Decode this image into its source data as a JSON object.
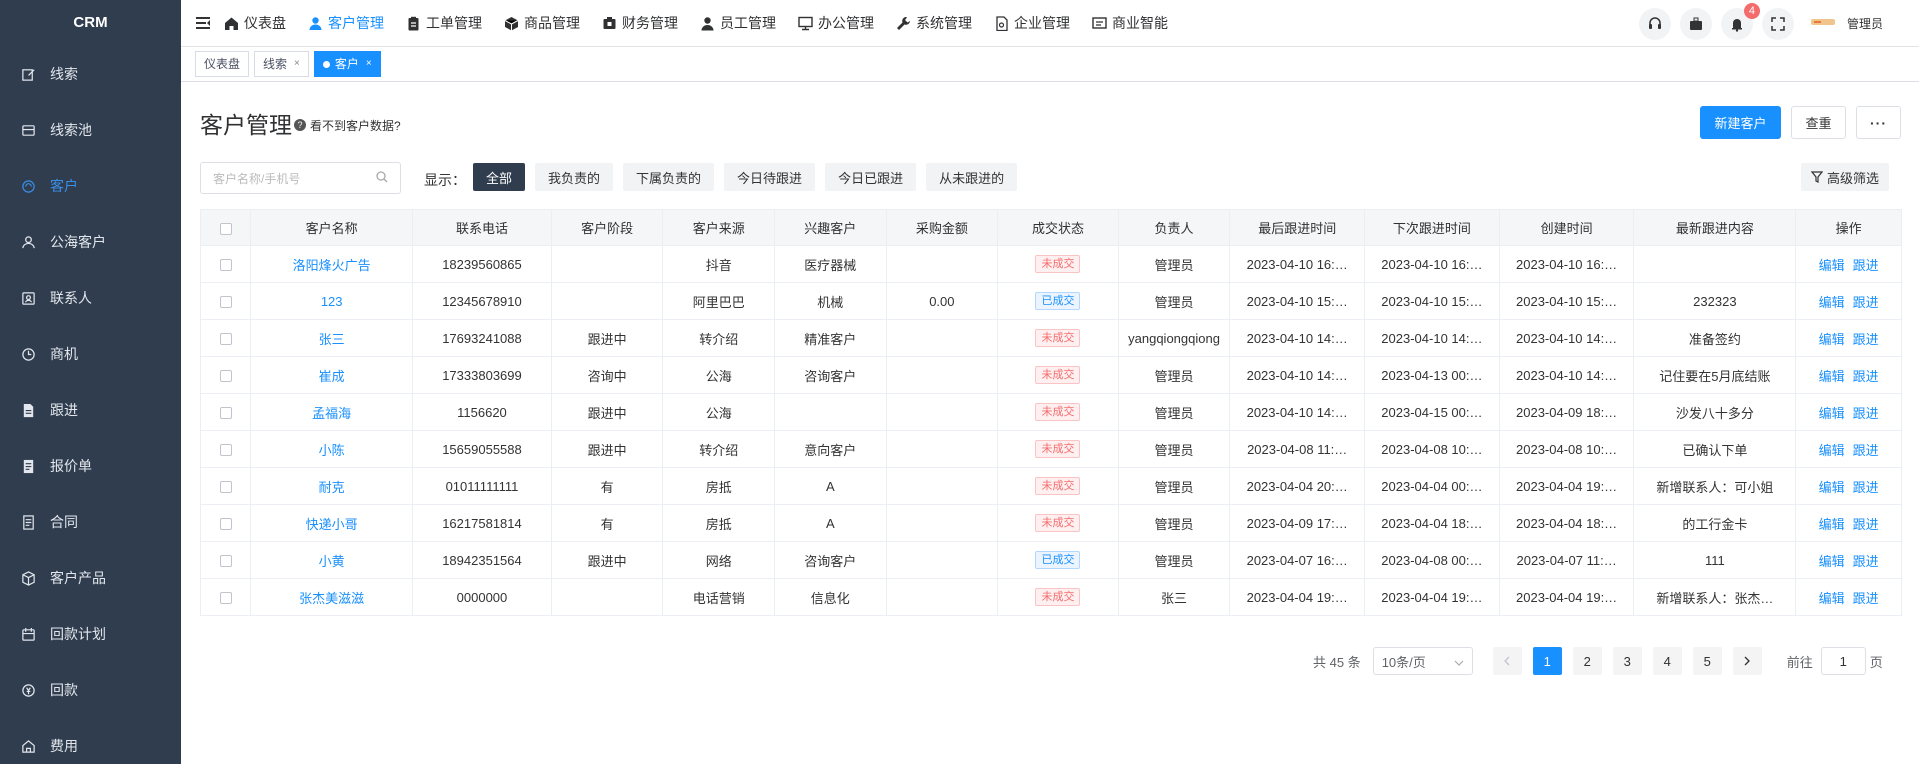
{
  "sidebar": {
    "brand": "CRM",
    "items": [
      {
        "label": "线索",
        "icon": "edit-icon"
      },
      {
        "label": "线索池",
        "icon": "pool-icon"
      },
      {
        "label": "客户",
        "icon": "customer-icon",
        "active": true
      },
      {
        "label": "公海客户",
        "icon": "user-icon"
      },
      {
        "label": "联系人",
        "icon": "contact-icon"
      },
      {
        "label": "商机",
        "icon": "opportunity-icon"
      },
      {
        "label": "跟进",
        "icon": "followup-icon"
      },
      {
        "label": "报价单",
        "icon": "quote-icon"
      },
      {
        "label": "合同",
        "icon": "contract-icon"
      },
      {
        "label": "客户产品",
        "icon": "product-icon"
      },
      {
        "label": "回款计划",
        "icon": "plan-icon"
      },
      {
        "label": "回款",
        "icon": "payment-icon"
      },
      {
        "label": "费用",
        "icon": "expense-icon"
      }
    ]
  },
  "topnav": {
    "items": [
      {
        "label": "仪表盘",
        "icon": "home-icon"
      },
      {
        "label": "客户管理",
        "icon": "user-icon",
        "active": true
      },
      {
        "label": "工单管理",
        "icon": "clipboard-icon"
      },
      {
        "label": "商品管理",
        "icon": "box-icon"
      },
      {
        "label": "财务管理",
        "icon": "finance-icon"
      },
      {
        "label": "员工管理",
        "icon": "staff-icon"
      },
      {
        "label": "办公管理",
        "icon": "office-icon"
      },
      {
        "label": "系统管理",
        "icon": "wrench-icon"
      },
      {
        "label": "企业管理",
        "icon": "enterprise-icon"
      },
      {
        "label": "商业智能",
        "icon": "bi-icon"
      }
    ],
    "notification_count": "4",
    "admin_name": "管理员"
  },
  "tabs": [
    {
      "label": "仪表盘",
      "closable": false
    },
    {
      "label": "线索",
      "closable": true
    },
    {
      "label": "客户",
      "closable": true,
      "active": true
    }
  ],
  "page": {
    "title": "客户管理",
    "help_text": "看不到客户数据?",
    "new_button": "新建客户",
    "recheck_button": "查重",
    "more_button": "···",
    "search_placeholder": "客户名称/手机号",
    "show_label": "显示：",
    "filters": [
      "全部",
      "我负责的",
      "下属负责的",
      "今日待跟进",
      "今日已跟进",
      "从未跟进的"
    ],
    "active_filter": "全部",
    "advanced_filter": "高级筛选"
  },
  "table": {
    "headers": [
      "客户名称",
      "联系电话",
      "客户阶段",
      "客户来源",
      "兴趣客户",
      "采购金额",
      "成交状态",
      "负责人",
      "最后跟进时间",
      "下次跟进时间",
      "创建时间",
      "最新跟进内容",
      "操作"
    ],
    "rows": [
      [
        "洛阳烽火广告",
        "18239560865",
        "",
        "抖音",
        "医疗器械",
        "",
        "未成交",
        "管理员",
        "2023-04-10 16:…",
        "2023-04-10 16:…",
        "2023-04-10 16:…",
        ""
      ],
      [
        "123",
        "12345678910",
        "",
        "阿里巴巴",
        "机械",
        "0.00",
        "已成交",
        "管理员",
        "2023-04-10 15:…",
        "2023-04-10 15:…",
        "2023-04-10 15:…",
        "232323"
      ],
      [
        "张三",
        "17693241088",
        "跟进中",
        "转介绍",
        "精准客户",
        "",
        "未成交",
        "yangqiongqiong",
        "2023-04-10 14:…",
        "2023-04-10 14:…",
        "2023-04-10 14:…",
        "准备签约"
      ],
      [
        "崔成",
        "17333803699",
        "咨询中",
        "公海",
        "咨询客户",
        "",
        "未成交",
        "管理员",
        "2023-04-10 14:…",
        "2023-04-13 00:…",
        "2023-04-10 14:…",
        "记住要在5月底结账"
      ],
      [
        "孟福海",
        "1156620",
        "跟进中",
        "公海",
        "",
        "",
        "未成交",
        "管理员",
        "2023-04-10 14:…",
        "2023-04-15 00:…",
        "2023-04-09 18:…",
        "沙发八十多分"
      ],
      [
        "小陈",
        "15659055588",
        "跟进中",
        "转介绍",
        "意向客户",
        "",
        "未成交",
        "管理员",
        "2023-04-08 11:…",
        "2023-04-08 10:…",
        "2023-04-08 10:…",
        "已确认下单"
      ],
      [
        "耐克",
        "01011111111",
        "有",
        "房抵",
        "A",
        "",
        "未成交",
        "管理员",
        "2023-04-04 20:…",
        "2023-04-04 00:…",
        "2023-04-04 19:…",
        "新增联系人：可小姐"
      ],
      [
        "快递小哥",
        "16217581814",
        "有",
        "房抵",
        "A",
        "",
        "未成交",
        "管理员",
        "2023-04-09 17:…",
        "2023-04-04 18:…",
        "2023-04-04 18:…",
        "的工行金卡"
      ],
      [
        "小黄",
        "18942351564",
        "跟进中",
        "网络",
        "咨询客户",
        "",
        "已成交",
        "管理员",
        "2023-04-07 16:…",
        "2023-04-08 00:…",
        "2023-04-07 11:…",
        "111"
      ],
      [
        "张杰美滋滋",
        "0000000",
        "",
        "电话营销",
        "信息化",
        "",
        "未成交",
        "张三",
        "2023-04-04 19:…",
        "2023-04-04 19:…",
        "2023-04-04 19:…",
        "新增联系人：张杰…"
      ]
    ],
    "actions": {
      "edit": "编辑",
      "follow": "跟进"
    }
  },
  "pagination": {
    "total": "共 45 条",
    "page_size": "10条/页",
    "pages": [
      "1",
      "2",
      "3",
      "4",
      "5"
    ],
    "current": "1",
    "goto_label": "前往",
    "goto_value": "1",
    "page_unit": "页"
  },
  "colors": {
    "primary": "#1890ff",
    "sidebar": "#2f3d4e",
    "danger": "#f56c6c"
  }
}
